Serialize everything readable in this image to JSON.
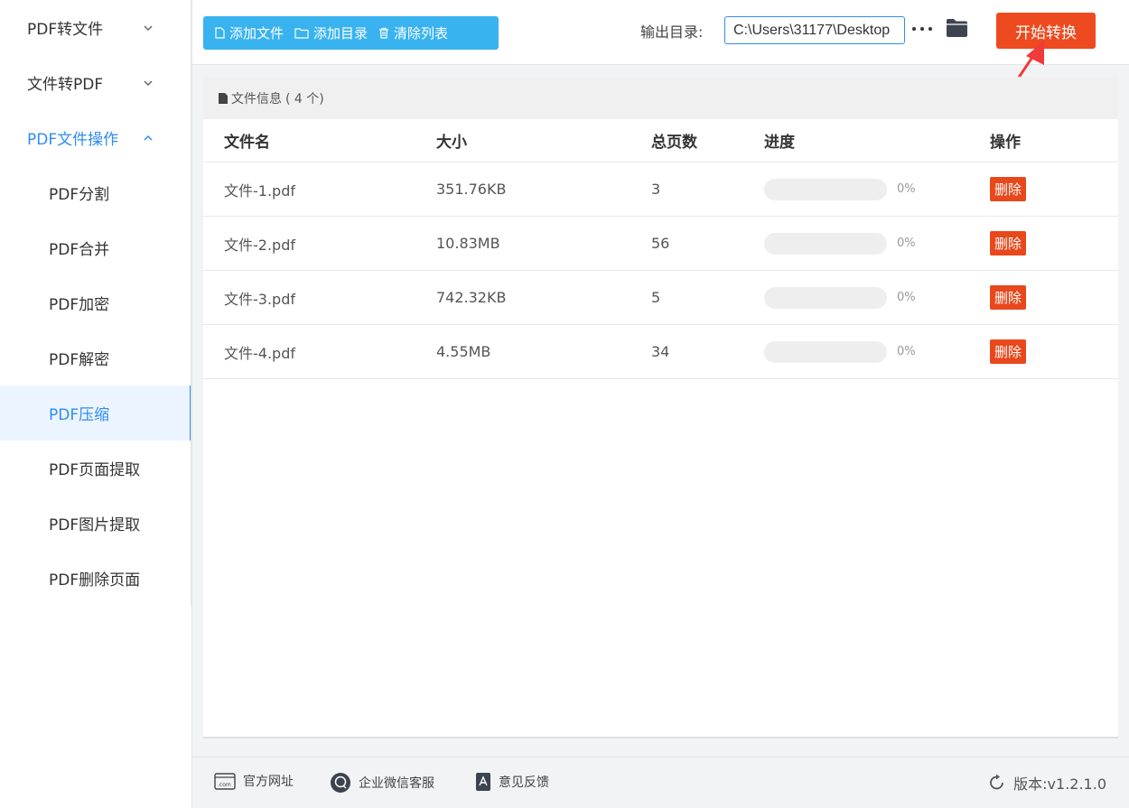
{
  "sidebar": {
    "groups": [
      {
        "label": "PDF转文件",
        "state": "collapsed"
      },
      {
        "label": "文件转PDF",
        "state": "collapsed"
      },
      {
        "label": "PDF文件操作",
        "state": "expanded"
      }
    ],
    "sub_items": [
      {
        "label": "PDF分割"
      },
      {
        "label": "PDF合并"
      },
      {
        "label": "PDF加密"
      },
      {
        "label": "PDF解密"
      },
      {
        "label": "PDF压缩",
        "active": true
      },
      {
        "label": "PDF页面提取"
      },
      {
        "label": "PDF图片提取"
      },
      {
        "label": "PDF删除页面"
      }
    ]
  },
  "toolbar": {
    "add_file": "添加文件",
    "add_dir": "添加目录",
    "clear_list": "清除列表",
    "output_label": "输出目录:",
    "output_value": "C:\\Users\\31177\\Desktop",
    "start_button": "开始转换"
  },
  "panel": {
    "title": "文件信息",
    "count": "( 4 个)",
    "columns": {
      "name": "文件名",
      "size": "大小",
      "pages": "总页数",
      "progress": "进度",
      "action": "操作"
    },
    "rows": [
      {
        "name": "文件-1.pdf",
        "size": "351.76KB",
        "pages": "3",
        "progress_text": "0%",
        "progress": 0,
        "action": "删除"
      },
      {
        "name": "文件-2.pdf",
        "size": "10.83MB",
        "pages": "56",
        "progress_text": "0%",
        "progress": 0,
        "action": "删除"
      },
      {
        "name": "文件-3.pdf",
        "size": "742.32KB",
        "pages": "5",
        "progress_text": "0%",
        "progress": 0,
        "action": "删除"
      },
      {
        "name": "文件-4.pdf",
        "size": "4.55MB",
        "pages": "34",
        "progress_text": "0%",
        "progress": 0,
        "action": "删除"
      }
    ]
  },
  "footer": {
    "website": "官方网址",
    "wechat": "企业微信客服",
    "feedback": "意见反馈",
    "version": "版本:v1.2.1.0"
  },
  "colors": {
    "accent": "#2f8cf0",
    "toolbar_bg": "#39b3f0",
    "start_button": "#ee4a1f",
    "delete_button": "#e8481c",
    "annotation_arrow": "#ef3b3b"
  },
  "icons": [
    "chevron-down-icon",
    "chevron-up-icon",
    "file-icon",
    "folder-outline-icon",
    "trash-icon",
    "more-icon",
    "folder-icon",
    "document-icon",
    "website-icon",
    "chat-icon",
    "feedback-icon",
    "refresh-icon"
  ]
}
